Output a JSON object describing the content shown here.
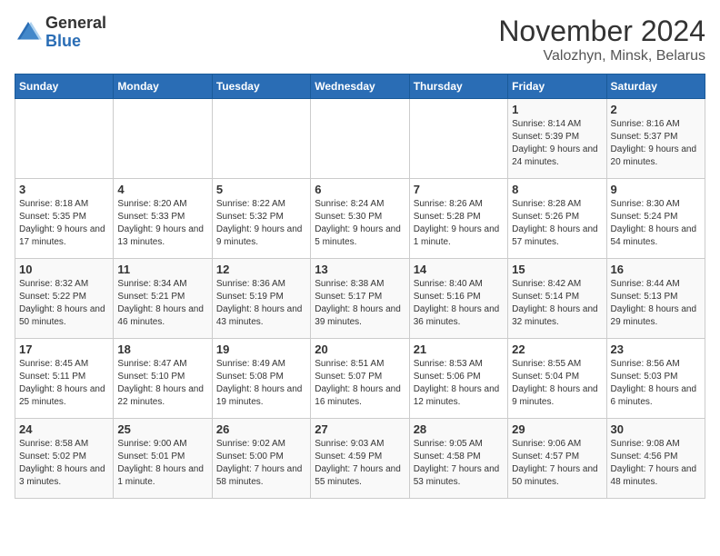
{
  "logo": {
    "text_general": "General",
    "text_blue": "Blue"
  },
  "header": {
    "month": "November 2024",
    "location": "Valozhyn, Minsk, Belarus"
  },
  "weekdays": [
    "Sunday",
    "Monday",
    "Tuesday",
    "Wednesday",
    "Thursday",
    "Friday",
    "Saturday"
  ],
  "weeks": [
    [
      {
        "day": "",
        "info": ""
      },
      {
        "day": "",
        "info": ""
      },
      {
        "day": "",
        "info": ""
      },
      {
        "day": "",
        "info": ""
      },
      {
        "day": "",
        "info": ""
      },
      {
        "day": "1",
        "info": "Sunrise: 8:14 AM\nSunset: 5:39 PM\nDaylight: 9 hours and 24 minutes."
      },
      {
        "day": "2",
        "info": "Sunrise: 8:16 AM\nSunset: 5:37 PM\nDaylight: 9 hours and 20 minutes."
      }
    ],
    [
      {
        "day": "3",
        "info": "Sunrise: 8:18 AM\nSunset: 5:35 PM\nDaylight: 9 hours and 17 minutes."
      },
      {
        "day": "4",
        "info": "Sunrise: 8:20 AM\nSunset: 5:33 PM\nDaylight: 9 hours and 13 minutes."
      },
      {
        "day": "5",
        "info": "Sunrise: 8:22 AM\nSunset: 5:32 PM\nDaylight: 9 hours and 9 minutes."
      },
      {
        "day": "6",
        "info": "Sunrise: 8:24 AM\nSunset: 5:30 PM\nDaylight: 9 hours and 5 minutes."
      },
      {
        "day": "7",
        "info": "Sunrise: 8:26 AM\nSunset: 5:28 PM\nDaylight: 9 hours and 1 minute."
      },
      {
        "day": "8",
        "info": "Sunrise: 8:28 AM\nSunset: 5:26 PM\nDaylight: 8 hours and 57 minutes."
      },
      {
        "day": "9",
        "info": "Sunrise: 8:30 AM\nSunset: 5:24 PM\nDaylight: 8 hours and 54 minutes."
      }
    ],
    [
      {
        "day": "10",
        "info": "Sunrise: 8:32 AM\nSunset: 5:22 PM\nDaylight: 8 hours and 50 minutes."
      },
      {
        "day": "11",
        "info": "Sunrise: 8:34 AM\nSunset: 5:21 PM\nDaylight: 8 hours and 46 minutes."
      },
      {
        "day": "12",
        "info": "Sunrise: 8:36 AM\nSunset: 5:19 PM\nDaylight: 8 hours and 43 minutes."
      },
      {
        "day": "13",
        "info": "Sunrise: 8:38 AM\nSunset: 5:17 PM\nDaylight: 8 hours and 39 minutes."
      },
      {
        "day": "14",
        "info": "Sunrise: 8:40 AM\nSunset: 5:16 PM\nDaylight: 8 hours and 36 minutes."
      },
      {
        "day": "15",
        "info": "Sunrise: 8:42 AM\nSunset: 5:14 PM\nDaylight: 8 hours and 32 minutes."
      },
      {
        "day": "16",
        "info": "Sunrise: 8:44 AM\nSunset: 5:13 PM\nDaylight: 8 hours and 29 minutes."
      }
    ],
    [
      {
        "day": "17",
        "info": "Sunrise: 8:45 AM\nSunset: 5:11 PM\nDaylight: 8 hours and 25 minutes."
      },
      {
        "day": "18",
        "info": "Sunrise: 8:47 AM\nSunset: 5:10 PM\nDaylight: 8 hours and 22 minutes."
      },
      {
        "day": "19",
        "info": "Sunrise: 8:49 AM\nSunset: 5:08 PM\nDaylight: 8 hours and 19 minutes."
      },
      {
        "day": "20",
        "info": "Sunrise: 8:51 AM\nSunset: 5:07 PM\nDaylight: 8 hours and 16 minutes."
      },
      {
        "day": "21",
        "info": "Sunrise: 8:53 AM\nSunset: 5:06 PM\nDaylight: 8 hours and 12 minutes."
      },
      {
        "day": "22",
        "info": "Sunrise: 8:55 AM\nSunset: 5:04 PM\nDaylight: 8 hours and 9 minutes."
      },
      {
        "day": "23",
        "info": "Sunrise: 8:56 AM\nSunset: 5:03 PM\nDaylight: 8 hours and 6 minutes."
      }
    ],
    [
      {
        "day": "24",
        "info": "Sunrise: 8:58 AM\nSunset: 5:02 PM\nDaylight: 8 hours and 3 minutes."
      },
      {
        "day": "25",
        "info": "Sunrise: 9:00 AM\nSunset: 5:01 PM\nDaylight: 8 hours and 1 minute."
      },
      {
        "day": "26",
        "info": "Sunrise: 9:02 AM\nSunset: 5:00 PM\nDaylight: 7 hours and 58 minutes."
      },
      {
        "day": "27",
        "info": "Sunrise: 9:03 AM\nSunset: 4:59 PM\nDaylight: 7 hours and 55 minutes."
      },
      {
        "day": "28",
        "info": "Sunrise: 9:05 AM\nSunset: 4:58 PM\nDaylight: 7 hours and 53 minutes."
      },
      {
        "day": "29",
        "info": "Sunrise: 9:06 AM\nSunset: 4:57 PM\nDaylight: 7 hours and 50 minutes."
      },
      {
        "day": "30",
        "info": "Sunrise: 9:08 AM\nSunset: 4:56 PM\nDaylight: 7 hours and 48 minutes."
      }
    ]
  ]
}
